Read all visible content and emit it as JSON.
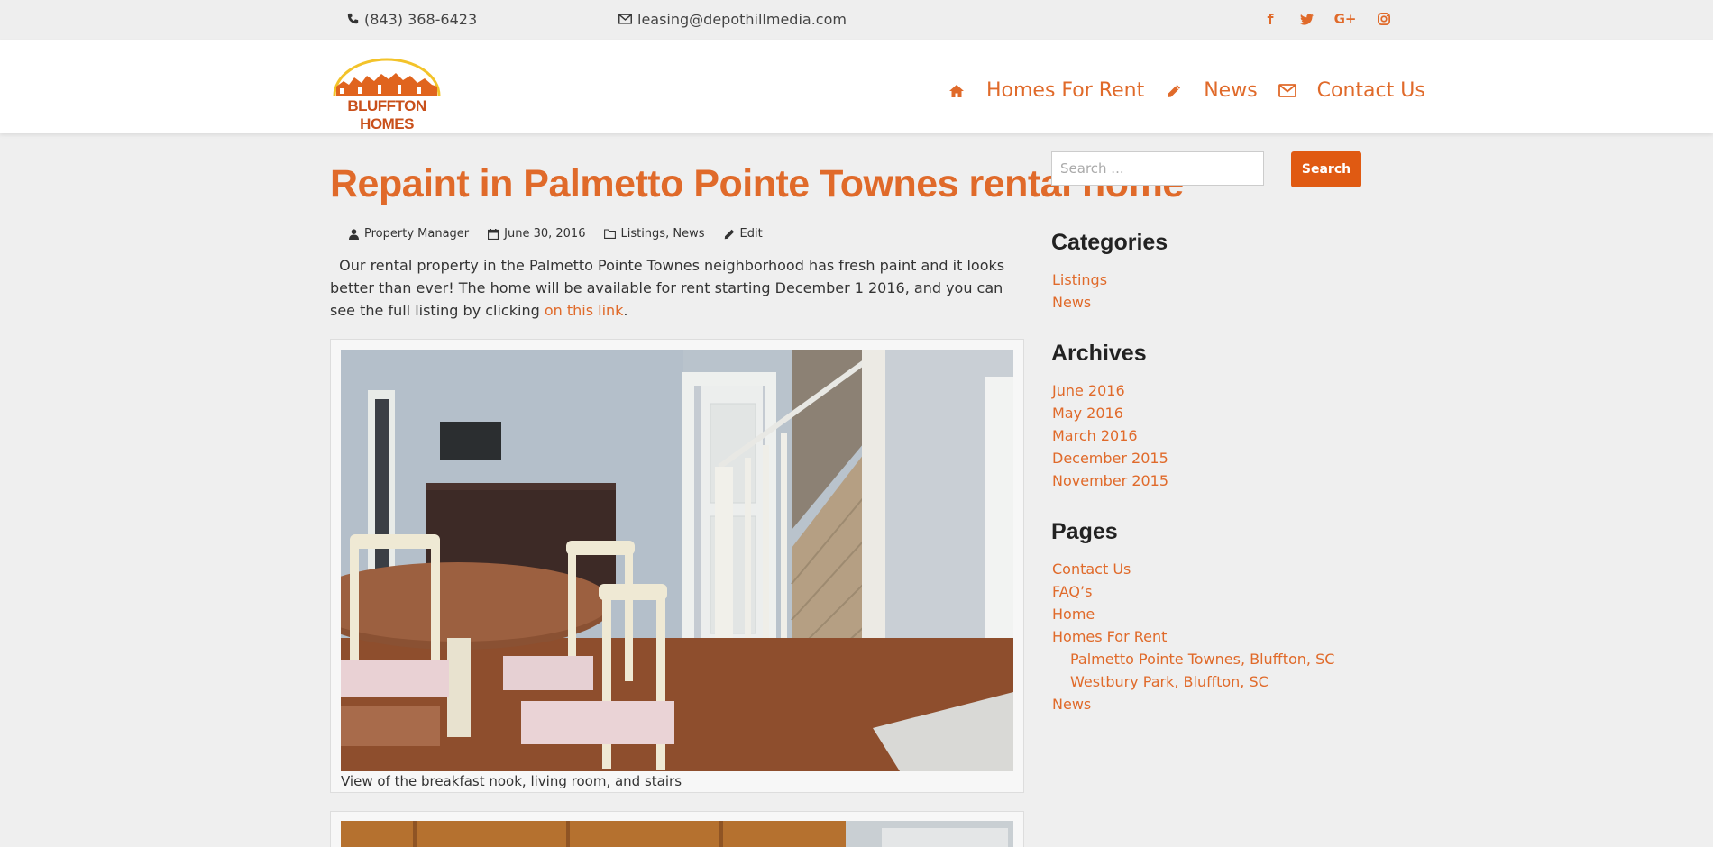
{
  "topbar": {
    "phone": "(843) 368-6423",
    "email": "leasing@depothillmedia.com",
    "socials": [
      "facebook-icon",
      "twitter-icon",
      "google-plus-icon",
      "instagram-icon"
    ]
  },
  "header": {
    "logo_text": "BLUFFTON HOMES",
    "nav": [
      {
        "icon": "home-icon",
        "label": "Homes For Rent"
      },
      {
        "icon": "pencil-icon",
        "label": "News"
      },
      {
        "icon": "envelope-icon",
        "label": "Contact Us"
      }
    ]
  },
  "post": {
    "title": "Repaint in Palmetto Pointe Townes rental home",
    "author": "Property Manager",
    "date": "June 30, 2016",
    "cat_listings": "Listings",
    "cat_sep": ",",
    "cat_news": "News",
    "edit": "Edit",
    "body_before": "Our rental property in the Palmetto Pointe Townes neighborhood has fresh paint and it looks better than ever! The home will be available for rent starting December 1 2016, and you can see the full listing by clicking ",
    "link_text": "on this link",
    "body_after": ".",
    "caption": "View of the breakfast nook, living room, and stairs"
  },
  "sidebar": {
    "search_placeholder": "Search ...",
    "search_button": "Search",
    "categories_title": "Categories",
    "categories": [
      "Listings",
      "News"
    ],
    "archives_title": "Archives",
    "archives": [
      "June 2016",
      "May 2016",
      "March 2016",
      "December 2015",
      "November 2015"
    ],
    "pages_title": "Pages",
    "pages": [
      {
        "label": "Contact Us",
        "sub": false
      },
      {
        "label": "FAQ’s",
        "sub": false
      },
      {
        "label": "Home",
        "sub": false
      },
      {
        "label": "Homes For Rent",
        "sub": false
      },
      {
        "label": "Palmetto Pointe Townes, Bluffton, SC",
        "sub": true
      },
      {
        "label": "Westbury Park, Bluffton, SC",
        "sub": true
      },
      {
        "label": "News",
        "sub": false
      }
    ]
  },
  "colors": {
    "accent": "#e06a2a",
    "button": "#e05a12",
    "background": "#efefef"
  }
}
